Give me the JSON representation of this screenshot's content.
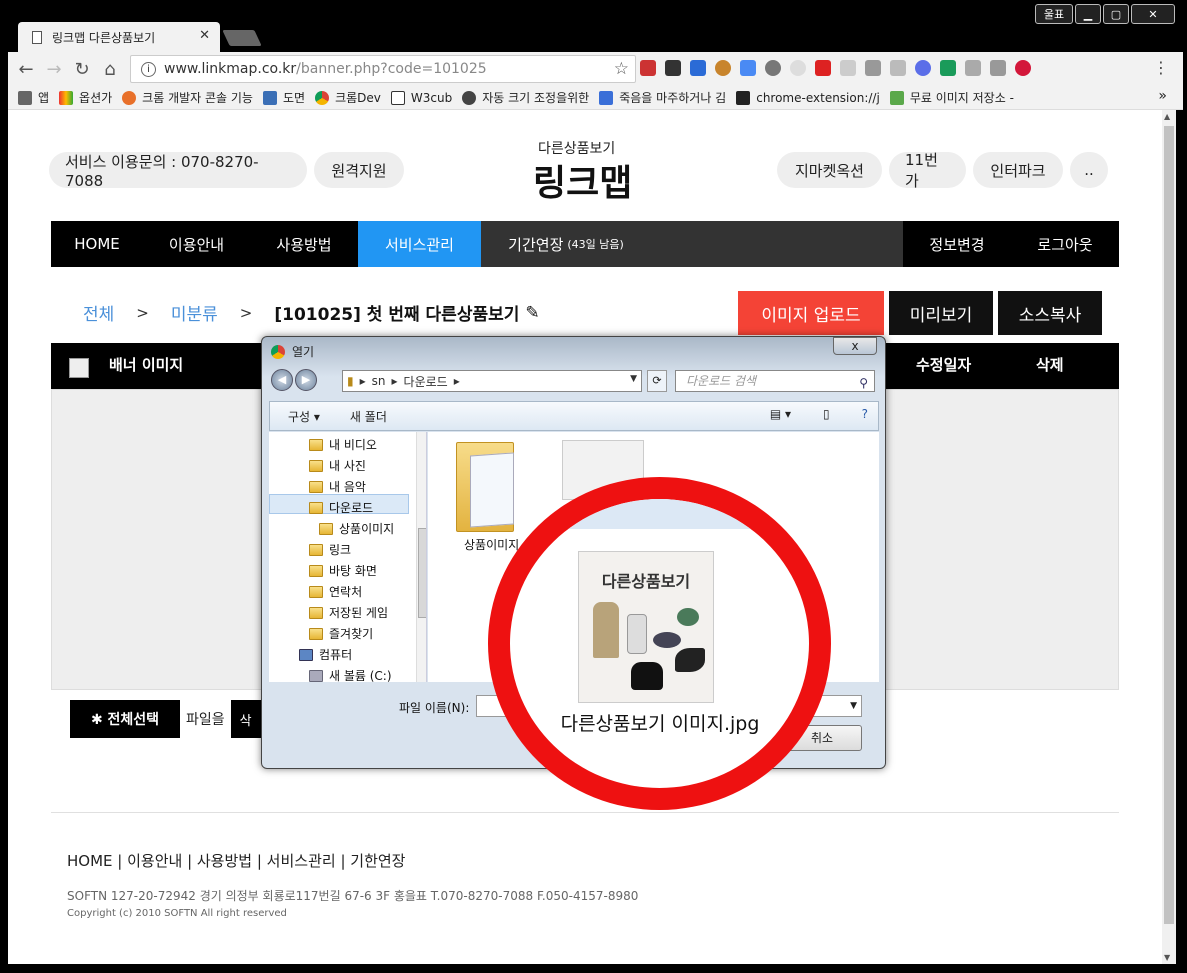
{
  "browser": {
    "tab_title": "링크맵 다른상품보기",
    "profile_label": "울표",
    "url_domain": "www.linkmap.co.kr",
    "url_path": "/banner.php?code=101025",
    "bookmarks": [
      "앱",
      "옵션가",
      "크롬 개발자 콘솔 기능",
      "도면",
      "크롬Dev",
      "W3cub",
      "자동 크기 조정을위한",
      "죽음을 마주하거나 김",
      "chrome-extension://j",
      "무료 이미지 저장소 -"
    ],
    "bookmarks_more": "»"
  },
  "header": {
    "contact": "서비스 이용문의 : 070-8270-7088",
    "remote": "원격지원",
    "site_sub": "다른상품보기",
    "site_name": "링크맵",
    "links": [
      "지마켓옥션",
      "11번가",
      "인터파크",
      ".."
    ]
  },
  "gnb": {
    "items": [
      "HOME",
      "이용안내",
      "사용방법",
      "서비스관리",
      "기간연장"
    ],
    "extend_days": "(43일 남음)",
    "right": [
      "정보변경",
      "로그아웃"
    ],
    "active_color": "#2196f3"
  },
  "breadcrumb": {
    "root": "전체",
    "sep": ">",
    "category": "미분류",
    "current": "[101025] 첫 번째 다른상품보기",
    "edit_icon": "pencil-icon"
  },
  "actions": {
    "upload": "이미지 업로드",
    "preview": "미리보기",
    "copy": "소스복사",
    "upload_color": "#f44336"
  },
  "table": {
    "col_image": "배너 이미지",
    "col_modified": "수정일자",
    "col_delete": "삭제"
  },
  "bottom": {
    "select_all": "✱ 전체선택",
    "file_text": "파일을",
    "partial_btn": "삭"
  },
  "footer": {
    "nav": "HOME | 이용안내 | 사용방법 | 서비스관리 | 기한연장",
    "address": "SOFTN 127-20-72942 경기 의정부 회룡로117번길 67-6 3F 홍을표 T.070-8270-7088 F.050-4157-8980",
    "copyright": "Copyright (c) 2010 SOFTN All right reserved"
  },
  "dialog": {
    "title": "열기",
    "close": "x",
    "path": [
      "sn",
      "다운로드"
    ],
    "search_placeholder": "다운로드 검색",
    "organize": "구성 ▾",
    "new_folder": "새 폴더",
    "tree": [
      "내 비디오",
      "내 사진",
      "내 음악",
      "다운로드",
      "상품이미지",
      "링크",
      "바탕 화면",
      "연락처",
      "저장된 게임",
      "즐겨찾기",
      "컴퓨터",
      "새 볼륨 (C:)"
    ],
    "folder_label": "상품이미지",
    "filename_label": "파일 이름(N):",
    "cancel": "취소"
  },
  "zoom": {
    "thumb_title": "다른상품보기",
    "file_label": "다른상품보기 이미지.jpg",
    "ring_color": "#ee1111"
  }
}
